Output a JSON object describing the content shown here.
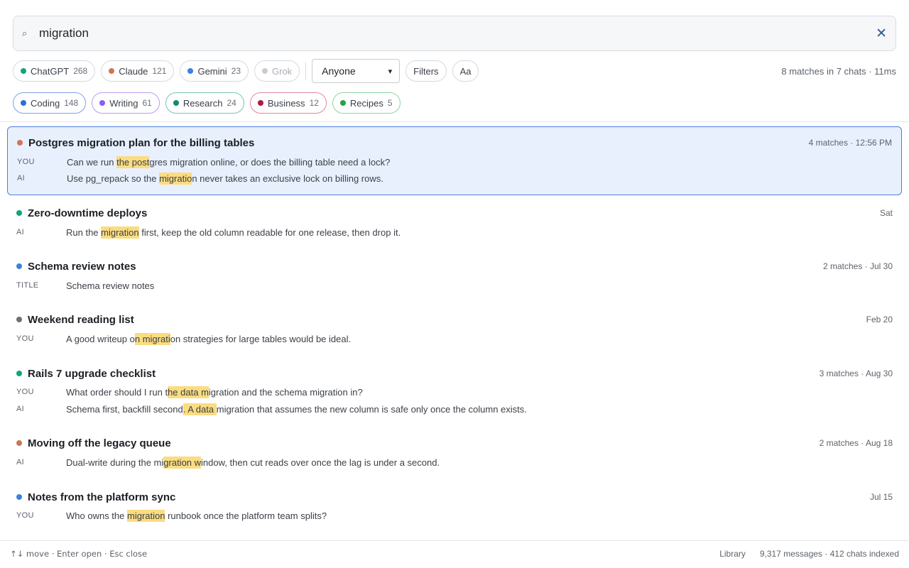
{
  "search": {
    "query": "migration",
    "search_icon": "search-icon",
    "clear_icon": "close-icon"
  },
  "providers": [
    {
      "label": "ChatGPT",
      "count": "268",
      "color": "#10a37f"
    },
    {
      "label": "Claude",
      "count": "121",
      "color": "#d07552"
    },
    {
      "label": "Gemini",
      "count": "23",
      "color": "#3b82e0"
    },
    {
      "label": "Grok",
      "count": "",
      "color": "#bfc3c8",
      "disabled": true
    }
  ],
  "author_select": {
    "value": "Anyone"
  },
  "filters_label": "Filters",
  "case_label": "Aa",
  "stats": "8 matches in 7 chats · 11ms",
  "topics": [
    {
      "label": "Coding",
      "count": "148",
      "color": "#2f6fd6",
      "border": "#7aa2e8"
    },
    {
      "label": "Writing",
      "count": "61",
      "color": "#8b5cf6",
      "border": "#b89cf3"
    },
    {
      "label": "Research",
      "count": "24",
      "color": "#0f8a73",
      "border": "#7cc2b3"
    },
    {
      "label": "Business",
      "count": "12",
      "color": "#b0183d",
      "border": "#e0889d"
    },
    {
      "label": "Recipes",
      "count": "5",
      "color": "#22a447",
      "border": "#8dd5a2"
    }
  ],
  "results": [
    {
      "title": "Postgres migration plan for the billing tables",
      "meta": "4 matches · 12:56 PM",
      "color": "#d07552",
      "lines": [
        {
          "role": "YOU",
          "pre": "Can we run ",
          "hl": "the post",
          "post": "gres migration online, or does the billing table need a lock?"
        },
        {
          "role": "AI",
          "pre": "Use pg_repack so the ",
          "hl": "migratio",
          "post": "n never takes an exclusive lock on billing rows."
        }
      ]
    },
    {
      "title": "Zero-downtime deploys",
      "meta": "Sat",
      "color": "#10a37f",
      "lines": [
        {
          "role": "AI",
          "pre": "Run the ",
          "hl": "migration",
          "post": " first, keep the old column readable for one release, then drop it."
        }
      ]
    },
    {
      "title": "Schema review notes",
      "meta": "2 matches · Jul 30",
      "color": "#3b82e0",
      "lines": [
        {
          "role": "TITLE",
          "pre": "Schema review notes",
          "hl": "",
          "post": ""
        }
      ]
    },
    {
      "title": "Weekend reading list",
      "meta": "Feb 20",
      "color": "#6b7078",
      "lines": [
        {
          "role": "YOU",
          "pre": "A good writeup o",
          "hl": "n migrati",
          "post": "on strategies for large tables would be ideal."
        }
      ]
    },
    {
      "title": "Rails 7 upgrade checklist",
      "meta": "3 matches · Aug 30",
      "color": "#10a37f",
      "lines": [
        {
          "role": "YOU",
          "pre": "What order should I run t",
          "hl": "he data m",
          "post": "igration and the schema migration in?"
        },
        {
          "role": "AI",
          "pre": "Schema first, backfill second",
          "hl": ". A data ",
          "post": "migration that assumes the new column is safe only once the column exists."
        }
      ]
    },
    {
      "title": "Moving off the legacy queue",
      "meta": "2 matches · Aug 18",
      "color": "#d07552",
      "lines": [
        {
          "role": "AI",
          "pre": "Dual-write during the mi",
          "hl": "gration w",
          "post": "indow, then cut reads over once the lag is under a second."
        }
      ]
    },
    {
      "title": "Notes from the platform sync",
      "meta": "Jul 15",
      "color": "#3b82e0",
      "lines": [
        {
          "role": "YOU",
          "pre": "Who owns the ",
          "hl": "migration",
          "post": " runbook once the platform team splits?"
        }
      ]
    }
  ],
  "footer": {
    "hint": "↑↓ move · Enter open · Esc close",
    "library": "Library",
    "indexed": "9,317 messages · 412 chats indexed"
  }
}
